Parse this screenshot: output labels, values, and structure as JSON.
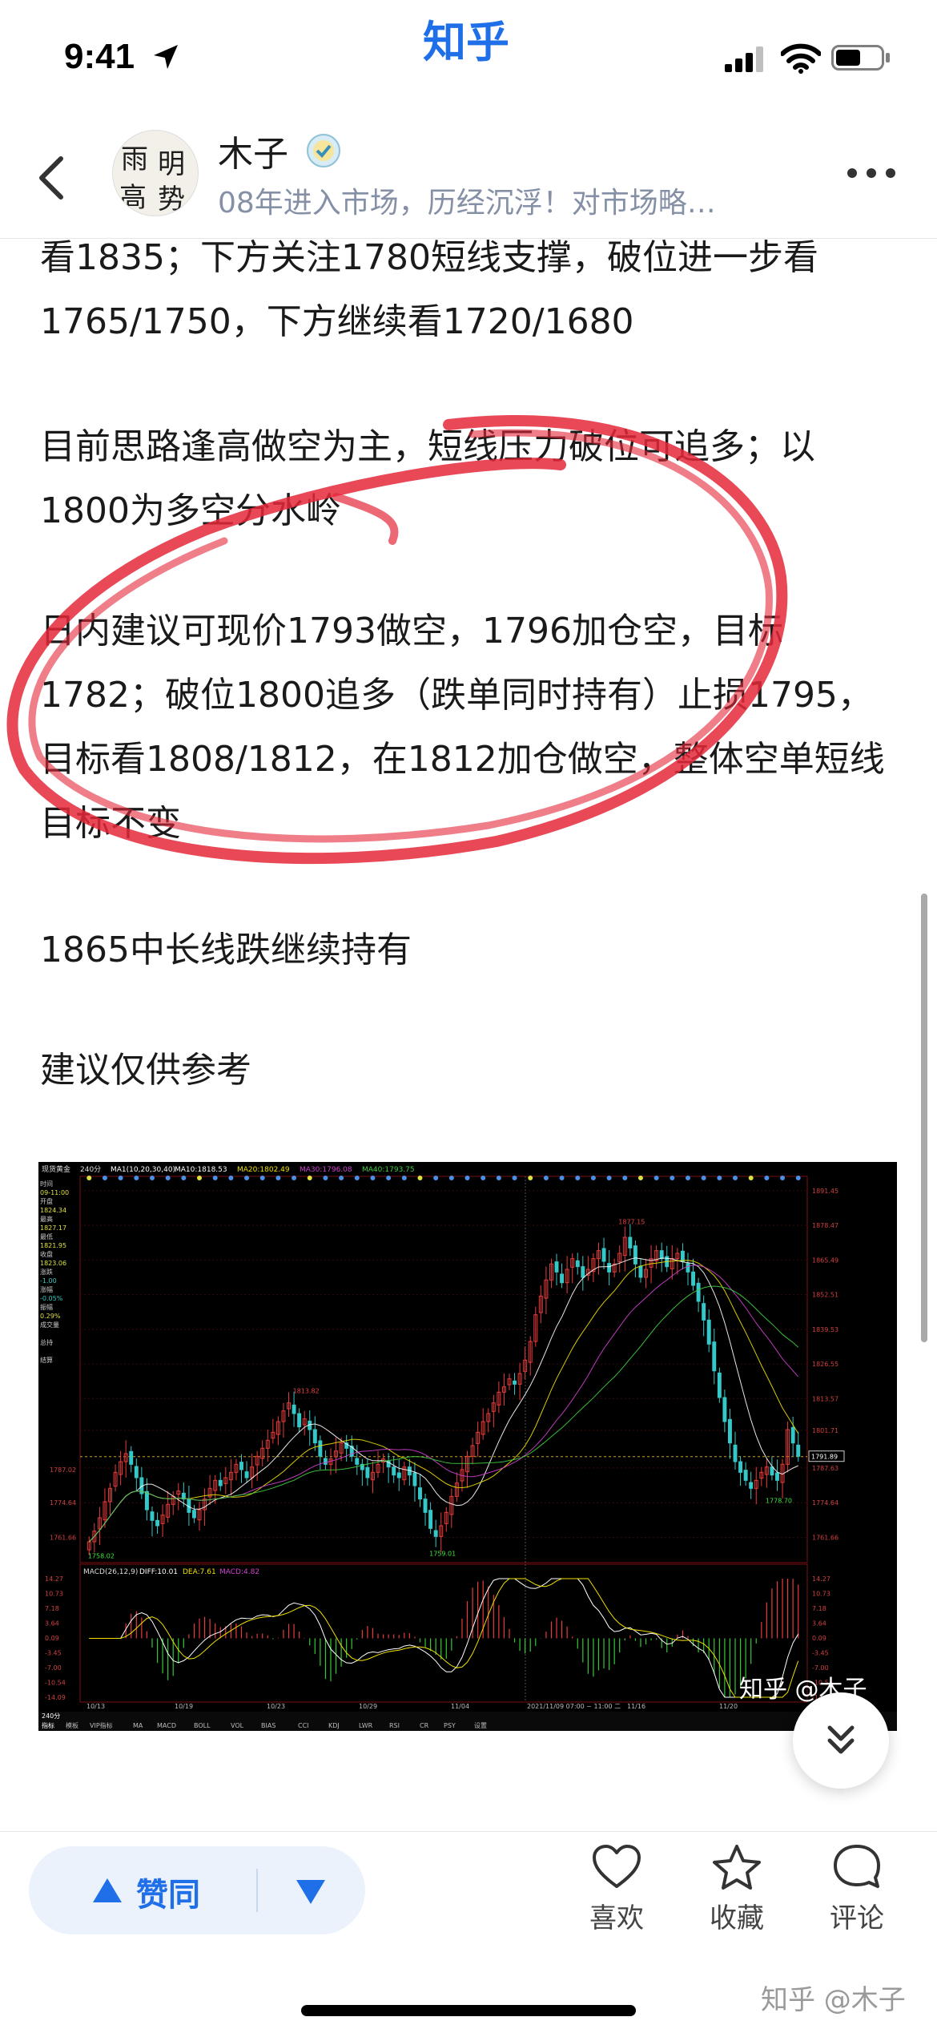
{
  "status_bar": {
    "time": "9:41",
    "app_name": "知乎"
  },
  "header": {
    "author_name": "木子",
    "author_bio": "08年进入市场，历经沉浮！对市场略…",
    "avatar_chars": [
      "雨",
      "明",
      "高",
      "势"
    ]
  },
  "article": {
    "paragraphs": [
      "看1835；下方关注1780短线支撑，破位进一步看1765/1750，下方继续看1720/1680",
      "目前思路逢高做空为主，短线压力破位可追多；以1800为多空分水岭",
      "日内建议可现价1793做空，1796加仓空，目标1782；破位1800追多（跌单同时持有）止损1795，目标看1808/1812，在1812加仓做空，整体空单短线目标不变",
      "1865中长线跌继续持有",
      "建议仅供参考"
    ]
  },
  "chart_data": {
    "type": "candlestick",
    "title": "现货黄金",
    "period": "240分",
    "indicator_label": "MA1(10,20,30,40)",
    "ma_readouts": [
      "MA10:1818.53",
      "MA20:1802.49",
      "MA30:1796.08",
      "MA40:1793.75"
    ],
    "ma_colors": [
      "#ffffff",
      "#f0e000",
      "#d040d0",
      "#40d040"
    ],
    "side_panel": [
      "时间",
      "09-11:00",
      "开盘",
      "1824.34",
      "最高",
      "1827.17",
      "最低",
      "1821.95",
      "收盘",
      "1823.06",
      "涨跌",
      "-1.00",
      "涨幅",
      "-0.05%",
      "振幅",
      "0.29%",
      "成交量",
      "",
      "总持",
      "",
      "结算"
    ],
    "price_axis": [
      "1891.45",
      "1878.47",
      "1865.49",
      "1852.51",
      "1839.53",
      "1826.55",
      "1813.57",
      "1801.71",
      "1787.63",
      "1774.64",
      "1761.66"
    ],
    "left_axis": [
      "1787.02",
      "1774.64",
      "1761.66"
    ],
    "current_price": "1791.89",
    "price_range": [
      1754,
      1895
    ],
    "annotations": [
      {
        "text": "1877.15",
        "price": 1877.15,
        "index": 102
      },
      {
        "text": "1813.82",
        "price": 1813.82,
        "index": 40
      },
      {
        "text": "1759.01",
        "price": 1759.01,
        "index": 66
      },
      {
        "text": "1758.02",
        "price": 1758.02,
        "index": 1
      },
      {
        "text": "1778.70",
        "price": 1778.7,
        "index": 130
      }
    ],
    "closes": [
      1760,
      1764,
      1769,
      1775,
      1780,
      1786,
      1790,
      1793,
      1789,
      1784,
      1778,
      1772,
      1768,
      1766,
      1770,
      1774,
      1777,
      1779,
      1776,
      1771,
      1769,
      1772,
      1776,
      1780,
      1783,
      1781,
      1784,
      1786,
      1789,
      1787,
      1784,
      1788,
      1792,
      1795,
      1798,
      1801,
      1805,
      1809,
      1812,
      1808,
      1803,
      1806,
      1802,
      1797,
      1792,
      1789,
      1791,
      1794,
      1797,
      1795,
      1792,
      1789,
      1787,
      1784,
      1786,
      1789,
      1791,
      1788,
      1785,
      1784,
      1788,
      1785,
      1781,
      1776,
      1771,
      1765,
      1762,
      1766,
      1771,
      1777,
      1782,
      1787,
      1792,
      1796,
      1801,
      1805,
      1808,
      1812,
      1816,
      1818,
      1821,
      1819,
      1823,
      1828,
      1835,
      1845,
      1852,
      1858,
      1864,
      1861,
      1857,
      1862,
      1866,
      1863,
      1859,
      1862,
      1866,
      1869,
      1865,
      1861,
      1864,
      1868,
      1874,
      1870,
      1864,
      1859,
      1862,
      1866,
      1869,
      1866,
      1863,
      1866,
      1868,
      1865,
      1861,
      1856,
      1850,
      1843,
      1834,
      1824,
      1814,
      1805,
      1797,
      1790,
      1786,
      1783,
      1780,
      1783,
      1786,
      1788,
      1785,
      1783,
      1789,
      1802,
      1797,
      1792
    ],
    "macd_label": "MACD(26,12,9)",
    "macd_readouts": [
      "DIFF:10.01",
      "DEA:7.61",
      "MACD:4.82"
    ],
    "macd_axis": [
      "14.27",
      "10.73",
      "7.18",
      "3.64",
      "0.09",
      "-3.45",
      "-7.00",
      "-10.54",
      "-14.09"
    ],
    "x_labels": [
      "10/13",
      "10/19",
      "10/23",
      "10/29",
      "11/04",
      "2021/11/09 07:00 ~ 11:00 二",
      "11/16",
      "11/20"
    ],
    "bottom_tabs": [
      "指标",
      "模板",
      "VIP指标",
      "MA",
      "MACD",
      "BOLL",
      "VOL",
      "BIAS",
      "CCI",
      "KDJ",
      "LWR",
      "RSI",
      "CR",
      "PSY",
      "设置"
    ],
    "tab_prefix": "240分",
    "chart_watermark": "知乎 @木子"
  },
  "bottom_bar": {
    "upvote_label": "赞同",
    "like_label": "喜欢",
    "collect_label": "收藏",
    "comment_label": "评论",
    "watermark": "知乎 @木子"
  },
  "colors": {
    "accent": "#1f6fe8",
    "vote_bg": "#ebf2fc",
    "candle_up": "#e83b3b",
    "candle_down": "#35c8c8",
    "annotation_circle": "#e5283a"
  }
}
